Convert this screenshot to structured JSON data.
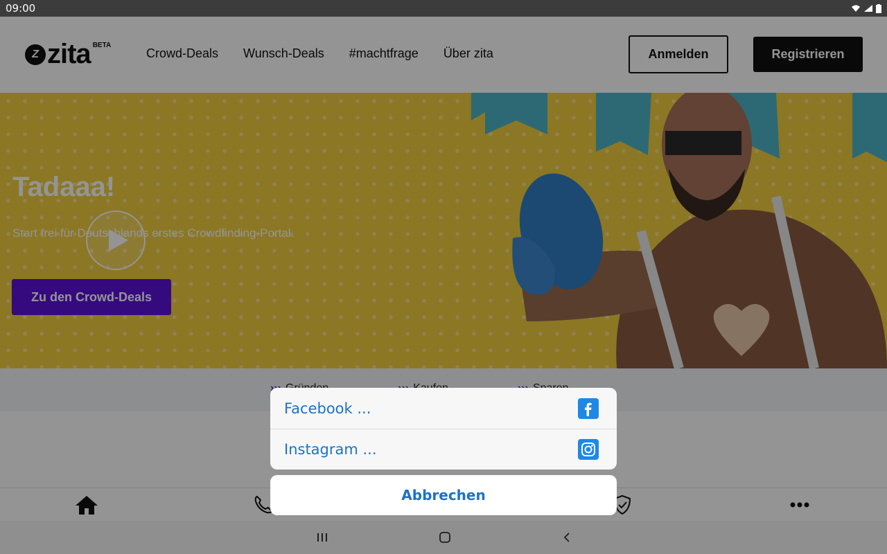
{
  "status_bar": {
    "time": "09:00"
  },
  "header": {
    "logo_mark": "Z",
    "logo_text": "zita",
    "logo_badge": "BETA",
    "nav": [
      "Crowd-Deals",
      "Wunsch-Deals",
      "#machtfrage",
      "Über zita"
    ],
    "login_label": "Anmelden",
    "register_label": "Registrieren"
  },
  "hero": {
    "title": "Tadaaa!",
    "subtitle": "Start frei für Deutschlands erstes Crowdfinding-Portal.",
    "cta_label": "Zu den Crowd-Deals"
  },
  "strip": {
    "items": [
      "Gründen",
      "Kaufen",
      "Sparen"
    ]
  },
  "share_sheet": {
    "options": [
      {
        "label": "Facebook ...",
        "icon": "facebook-icon"
      },
      {
        "label": "Instagram ...",
        "icon": "instagram-icon"
      }
    ],
    "cancel_label": "Abbrechen"
  },
  "bottom_nav": {
    "icons": [
      "home-icon",
      "phone-icon",
      "shield-check-icon",
      "more-icon"
    ]
  },
  "colors": {
    "accent_purple": "#5b12d9",
    "hero_yellow": "#f1cd3e",
    "ios_blue": "#1a73c7",
    "facebook_blue": "#1e88e5"
  }
}
